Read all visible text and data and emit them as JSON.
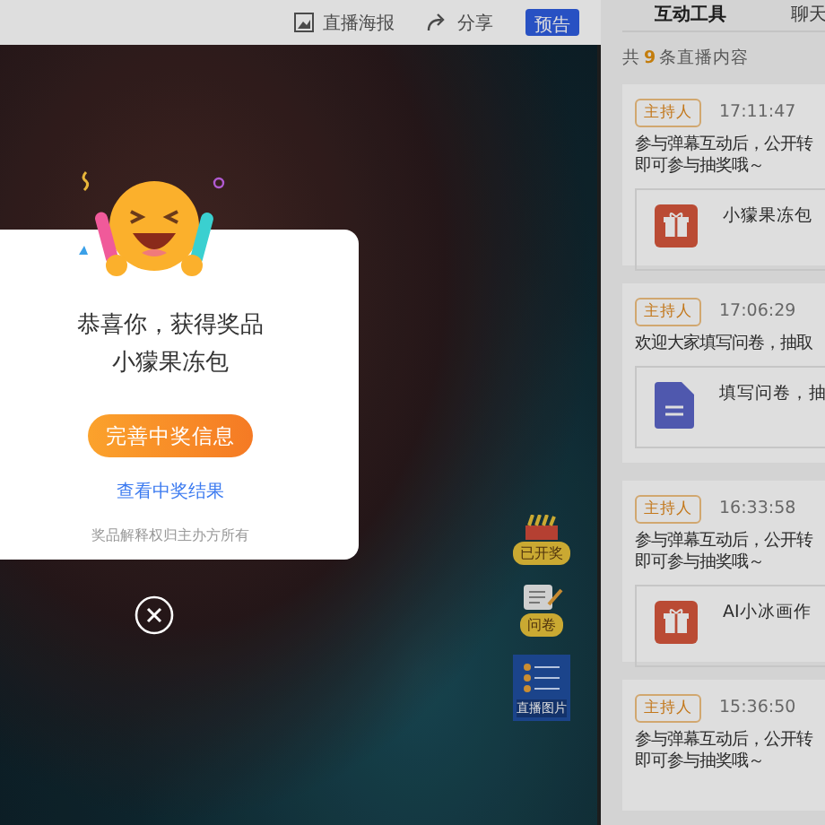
{
  "toolbar": {
    "items": [
      {
        "kind": "poster",
        "label": "直播海报"
      },
      {
        "kind": "share",
        "label": "分享"
      }
    ],
    "preview_button": "预告"
  },
  "video": {
    "widgets": [
      {
        "kind": "prize",
        "label": "已开奖"
      },
      {
        "kind": "survey",
        "label": "问卷"
      },
      {
        "kind": "photo",
        "label": "直播图片"
      }
    ]
  },
  "panel": {
    "tabs": [
      {
        "label": "互动工具",
        "selected": true
      },
      {
        "label": "聊天",
        "selected": false
      }
    ],
    "count": {
      "prefix": "共",
      "number": "9",
      "suffix": "条直播内容"
    },
    "posts": [
      {
        "tag": "主持人",
        "time": "17:11:47",
        "lines": [
          "参与弹幕互动后，公开转",
          "即可参与抽奖哦～"
        ],
        "attachment": {
          "kind": "gift",
          "title": "小獴果冻包"
        }
      },
      {
        "tag": "主持人",
        "time": "17:06:29",
        "lines": [
          "欢迎大家填写问卷，抽取"
        ],
        "attachment": {
          "kind": "survey",
          "title": "填写问卷，抽"
        }
      },
      {
        "tag": "主持人",
        "time": "16:33:58",
        "lines": [
          "参与弹幕互动后，公开转",
          "即可参与抽奖哦～"
        ],
        "attachment": {
          "kind": "gift",
          "title": "AI小冰画作"
        }
      },
      {
        "tag": "主持人",
        "time": "15:36:50",
        "lines": [
          "参与弹幕互动后，公开转",
          "即可参与抽奖哦～"
        ]
      }
    ]
  },
  "dialog": {
    "title_lines": [
      "恭喜你，获得奖品",
      "小獴果冻包"
    ],
    "primary_button": "完善中奖信息",
    "link": "查看中奖结果",
    "note": "奖品解释权归主办方所有"
  }
}
